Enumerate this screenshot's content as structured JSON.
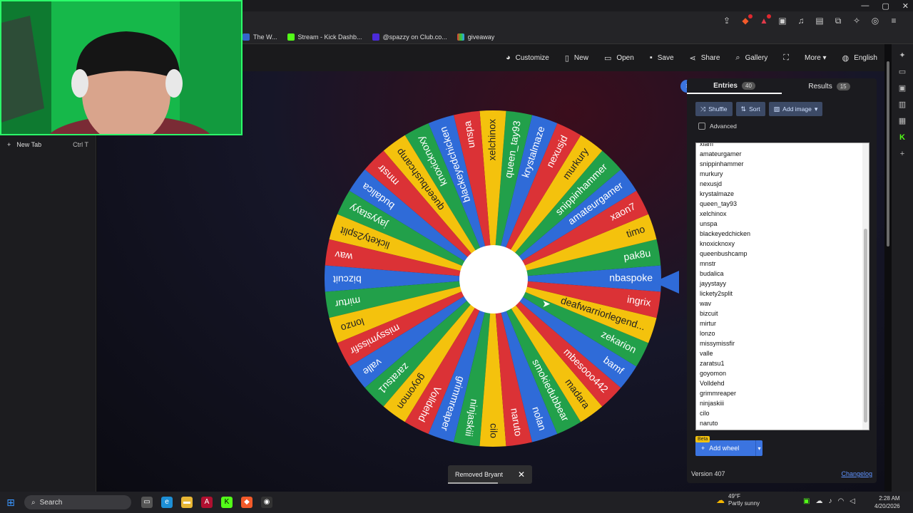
{
  "window": {
    "minimize": "—",
    "maximize": "▢",
    "close": "✕"
  },
  "bookmarks": [
    {
      "label": "The W...",
      "color": "#3366cc"
    },
    {
      "label": "Stream - Kick Dashb...",
      "color": "#53fc18"
    },
    {
      "label": "@spazzy on Club.co...",
      "color": "#4b2bd9"
    },
    {
      "label": "giveaway",
      "color": "#e33"
    }
  ],
  "tabs_panel": {
    "new_tab_label": "New Tab",
    "shortcut": "Ctrl  T"
  },
  "app_nav": [
    {
      "label": "Customize",
      "icon": "palette-icon",
      "glyph": "◕"
    },
    {
      "label": "New",
      "icon": "file-icon",
      "glyph": "▯"
    },
    {
      "label": "Open",
      "icon": "folder-icon",
      "glyph": "▭"
    },
    {
      "label": "Save",
      "icon": "save-icon",
      "glyph": "▪"
    },
    {
      "label": "Share",
      "icon": "share-icon",
      "glyph": "⋖"
    },
    {
      "label": "Gallery",
      "icon": "search-icon",
      "glyph": "⌕"
    },
    {
      "label": "",
      "icon": "fullscreen-icon",
      "glyph": "⛶"
    },
    {
      "label": "More ▾",
      "icon": "",
      "glyph": ""
    },
    {
      "label": "English",
      "icon": "globe-icon",
      "glyph": "◍"
    }
  ],
  "wheel": {
    "colors": [
      "#2f6bd8",
      "#22a04a",
      "#f4c20d",
      "#db3236"
    ],
    "segment_labels": [
      "nbaspoke",
      "pak8u",
      "timo",
      "xaon7",
      "amateurgamer",
      "snippinhammer",
      "murkury",
      "nexusjd",
      "krystalmaze",
      "queen_tay93",
      "xelchinox",
      "unspa",
      "blackeyedchicken",
      "knoxicknoxy",
      "queenbushcamp",
      "mnstr",
      "budalica",
      "jayystayy",
      "lickety2split",
      "wav",
      "bizcuit",
      "mirtur",
      "lonzo",
      "missymissfir",
      "valle",
      "zaratsu1",
      "goyomon",
      "Volldehd",
      "grimmreaper",
      "ninjaskiii",
      "cilo",
      "naruto",
      "nolan",
      "smokiedubbear",
      "madara",
      "mbesooo442",
      "bamf",
      "zekarion",
      "deafwarriorlegend...",
      "ingrix"
    ]
  },
  "toast": {
    "message": "Removed Bryant",
    "close": "✕"
  },
  "panel": {
    "entries_label": "Entries",
    "entries_count": "40",
    "results_label": "Results",
    "results_count": "15",
    "shuffle_label": "Shuffle",
    "sort_label": "Sort",
    "add_image_label": "Add image",
    "advanced_label": "Advanced",
    "entries_visible": [
      "xiam",
      "amateurgamer",
      "snippinhammer",
      "murkury",
      "nexusjd",
      "krystalmaze",
      "queen_tay93",
      "xelchinox",
      "unspa",
      "blackeyedchicken",
      "knoxicknoxy",
      "queenbushcamp",
      "mnstr",
      "budalica",
      "jayystayy",
      "lickety2split",
      "wav",
      "bizcuit",
      "mirtur",
      "lonzo",
      "missymissfir",
      "valle",
      "zaratsu1",
      "goyomon",
      "Volldehd",
      "grimmreaper",
      "ninjaskiii",
      "cilo",
      "naruto"
    ],
    "beta_label": "Beta",
    "add_wheel_label": "Add wheel",
    "version_label": "Version 407",
    "changelog_label": "Changelog"
  },
  "taskbar": {
    "search_label": "Search",
    "weather_temp": "49°F",
    "weather_desc": "Partly sunny",
    "time": "2:28 AM",
    "date": "4/20/2026"
  }
}
